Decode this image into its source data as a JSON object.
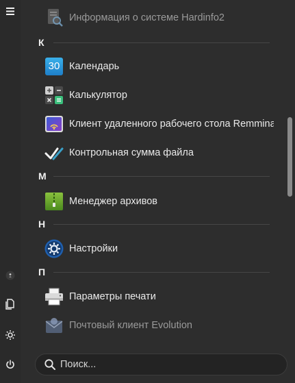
{
  "search": {
    "placeholder": "Поиск..."
  },
  "sections": [
    {
      "letter": "К"
    },
    {
      "letter": "М"
    },
    {
      "letter": "Н"
    },
    {
      "letter": "П"
    }
  ],
  "apps": [
    {
      "label": "Информация о системе Hardinfo2",
      "icon": "system-info-icon"
    },
    {
      "label": "Календарь",
      "icon": "calendar-icon",
      "icon_text": "30"
    },
    {
      "label": "Калькулятор",
      "icon": "calculator-icon"
    },
    {
      "label": "Клиент удаленного рабочего стола Remmina",
      "icon": "remote-desktop-icon"
    },
    {
      "label": "Контрольная сумма файла",
      "icon": "checksum-icon"
    },
    {
      "label": "Менеджер архивов",
      "icon": "archive-manager-icon"
    },
    {
      "label": "Настройки",
      "icon": "settings-app-icon"
    },
    {
      "label": "Параметры печати",
      "icon": "printer-icon"
    },
    {
      "label": "Почтовый клиент Evolution",
      "icon": "mail-client-icon"
    }
  ],
  "sidebar": {
    "items": [
      {
        "icon": "hamburger-menu-icon"
      },
      {
        "icon": "user-avatar-icon"
      },
      {
        "icon": "documents-icon"
      },
      {
        "icon": "gear-icon"
      },
      {
        "icon": "power-icon"
      }
    ]
  },
  "colors": {
    "background": "#2d2d2d",
    "accent_blue": "#2a86d6",
    "checksum_teal": "#3aa0c8",
    "archive_green": "#5a9a2a"
  }
}
